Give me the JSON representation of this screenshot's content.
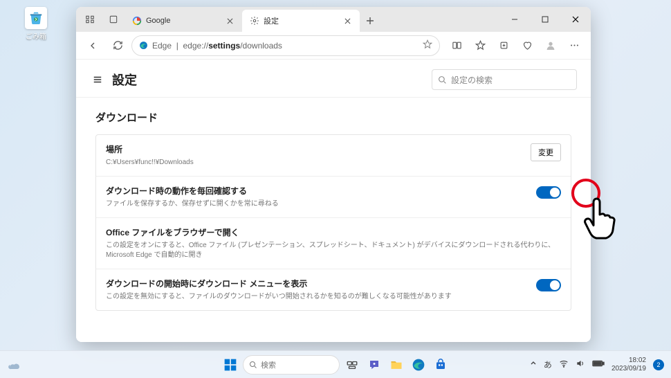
{
  "desktop": {
    "recycle_bin": "ごみ箱"
  },
  "browser": {
    "tabs": [
      {
        "title": "Google",
        "favicon": "google"
      },
      {
        "title": "設定",
        "favicon": "gear"
      }
    ],
    "address": {
      "prefix": "Edge",
      "sep": "|",
      "path_plain1": "edge://",
      "path_bold": "settings",
      "path_plain2": "/downloads"
    }
  },
  "settings": {
    "title": "設定",
    "search_placeholder": "設定の検索",
    "section": "ダウンロード",
    "rows": {
      "location": {
        "title": "場所",
        "desc": "C:¥Users¥func!!¥Downloads",
        "button": "変更"
      },
      "ask": {
        "title": "ダウンロード時の動作を毎回確認する",
        "desc": "ファイルを保存するか、保存せずに開くかを常に尋ねる"
      },
      "office": {
        "title": "Office ファイルをブラウザーで開く",
        "desc": "この設定をオンにすると、Office ファイル (プレゼンテーション、スプレッドシート、ドキュメント) がデバイスにダウンロードされる代わりに、Microsoft Edge で自動的に開き"
      },
      "menu": {
        "title": "ダウンロードの開始時にダウンロード メニューを表示",
        "desc": "この設定を無効にすると、ファイルのダウンロードがいつ開始されるかを知るのが難しくなる可能性があります"
      }
    }
  },
  "taskbar": {
    "search_placeholder": "検索",
    "ime": "あ",
    "time": "18:02",
    "date": "2023/09/19",
    "notif": "2"
  }
}
